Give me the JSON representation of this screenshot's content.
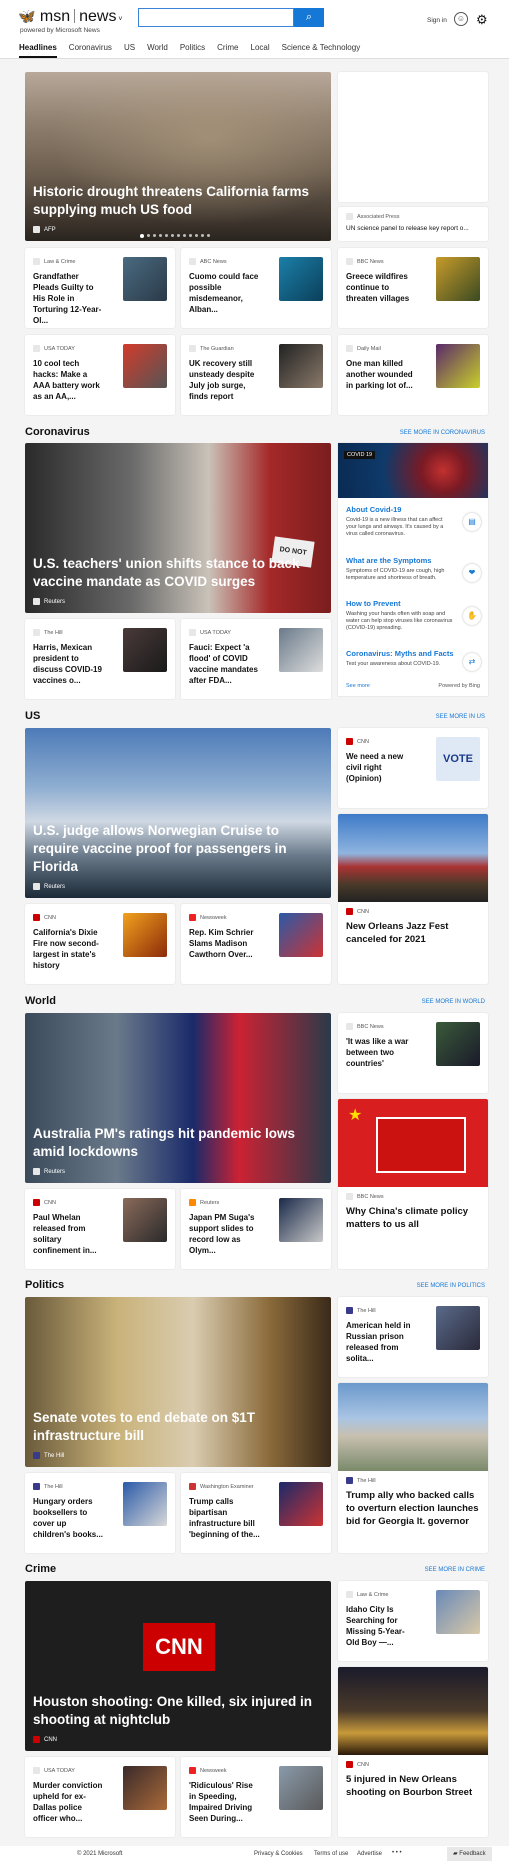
{
  "header": {
    "brand": "msn",
    "section": "news",
    "powered": "powered by Microsoft News",
    "search_placeholder": "",
    "signin": "Sign in"
  },
  "nav": [
    "Headlines",
    "Coronavirus",
    "US",
    "World",
    "Politics",
    "Crime",
    "Local",
    "Science & Technology"
  ],
  "headlines": {
    "hero_title": "Historic drought threatens California farms supplying much US food",
    "hero_source": "AFP",
    "side_src": "Associated Press",
    "side_title": "UN science panel to release key report o...",
    "row1": [
      {
        "src": "Law & Crime",
        "title": "Grandfather Pleads Guilty to His Role in Torturing 12-Year-Ol..."
      },
      {
        "src": "ABC News",
        "title": "Cuomo could face possible misdemeanor, Alban..."
      },
      {
        "src": "BBC News",
        "title": "Greece wildfires continue to threaten villages"
      }
    ],
    "row2": [
      {
        "src": "USA TODAY",
        "title": "10 cool tech hacks: Make a AAA battery work as an AA,..."
      },
      {
        "src": "The Guardian",
        "title": "UK recovery still unsteady despite July job surge, finds report"
      },
      {
        "src": "Daily Mail",
        "title": "One man killed another wounded in parking lot of..."
      }
    ]
  },
  "coronavirus": {
    "heading": "Coronavirus",
    "see_more": "SEE MORE IN CORONAVIRUS",
    "hero_title": "U.S. teachers' union shifts stance to back vaccine mandate as COVID surges",
    "hero_source": "Reuters",
    "badge": "COVID 19",
    "sign_text": "DO NOT",
    "items": [
      {
        "q": "About Covid-19",
        "d": "Covid-19 is a new illness that can affect your lungs and airways. It's caused by a virus called coronavirus."
      },
      {
        "q": "What are the Symptoms",
        "d": "Symptoms of COVID-19 are cough, high temperature and shortness of breath."
      },
      {
        "q": "How to Prevent",
        "d": "Washing your hands often with soap and water can help stop viruses like coronavirus (COVID-19) spreading."
      },
      {
        "q": "Coronavirus: Myths and Facts",
        "d": "Test your awareness about COVID-19."
      }
    ],
    "see_more_link": "See more",
    "powered": "Powered by Bing",
    "row": [
      {
        "src": "The Hill",
        "title": "Harris, Mexican president to discuss COVID-19 vaccines o..."
      },
      {
        "src": "USA TODAY",
        "title": "Fauci: Expect 'a flood' of COVID vaccine mandates after FDA..."
      }
    ]
  },
  "us": {
    "heading": "US",
    "see_more": "SEE MORE IN US",
    "hero_title": "U.S. judge allows Norwegian Cruise to require vaccine proof for passengers in Florida",
    "hero_source": "Reuters",
    "side1_src": "CNN",
    "side1_title": "We need a new civil right (Opinion)",
    "side1_sign": "VOTE",
    "side2_src": "CNN",
    "side2_title": "New Orleans Jazz Fest canceled for 2021",
    "row": [
      {
        "src": "CNN",
        "title": "California's Dixie Fire now second-largest in state's history"
      },
      {
        "src": "Newsweek",
        "title": "Rep. Kim Schrier Slams Madison Cawthorn Over..."
      }
    ]
  },
  "world": {
    "heading": "World",
    "see_more": "SEE MORE IN WORLD",
    "hero_title": "Australia PM's ratings hit pandemic lows amid lockdowns",
    "hero_source": "Reuters",
    "side1_src": "BBC News",
    "side1_title": "'It was like a war between two countries'",
    "side2_src": "BBC News",
    "side2_title": "Why China's climate policy matters to us all",
    "row": [
      {
        "src": "CNN",
        "title": "Paul Whelan released from solitary confinement in..."
      },
      {
        "src": "Reuters",
        "title": "Japan PM Suga's support slides to record low as Olym..."
      }
    ]
  },
  "politics": {
    "heading": "Politics",
    "see_more": "SEE MORE IN POLITICS",
    "hero_title": "Senate votes to end debate on $1T infrastructure bill",
    "hero_source": "The Hill",
    "side1_src": "The Hill",
    "side1_title": "American held in Russian prison released from solita...",
    "side2_src": "The Hill",
    "side2_title": "Trump ally who backed calls to overturn election launches bid for Georgia lt. governor",
    "row": [
      {
        "src": "The Hill",
        "title": "Hungary orders booksellers to cover up children's books..."
      },
      {
        "src": "Washington Examiner",
        "title": "Trump calls bipartisan infrastructure bill 'beginning of the..."
      }
    ]
  },
  "crime": {
    "heading": "Crime",
    "see_more": "SEE MORE IN CRIME",
    "hero_title": "Houston shooting: One killed, six injured in shooting at nightclub",
    "hero_source": "CNN",
    "logo_text": "CNN",
    "side1_src": "Law & Crime",
    "side1_title": "Idaho City Is Searching for Missing 5-Year-Old Boy —...",
    "side2_src": "CNN",
    "side2_title": "5 injured in New Orleans shooting on Bourbon Street",
    "row": [
      {
        "src": "USA TODAY",
        "title": "Murder conviction upheld for ex-Dallas police officer who..."
      },
      {
        "src": "Newsweek",
        "title": "'Ridiculous' Rise in Speeding, Impaired Driving Seen During..."
      }
    ]
  },
  "footer": {
    "copyright": "© 2021 Microsoft",
    "privacy": "Privacy & Cookies",
    "terms": "Terms of use",
    "advertise": "Advertise",
    "more": "• • •",
    "feedback": "Feedback"
  }
}
